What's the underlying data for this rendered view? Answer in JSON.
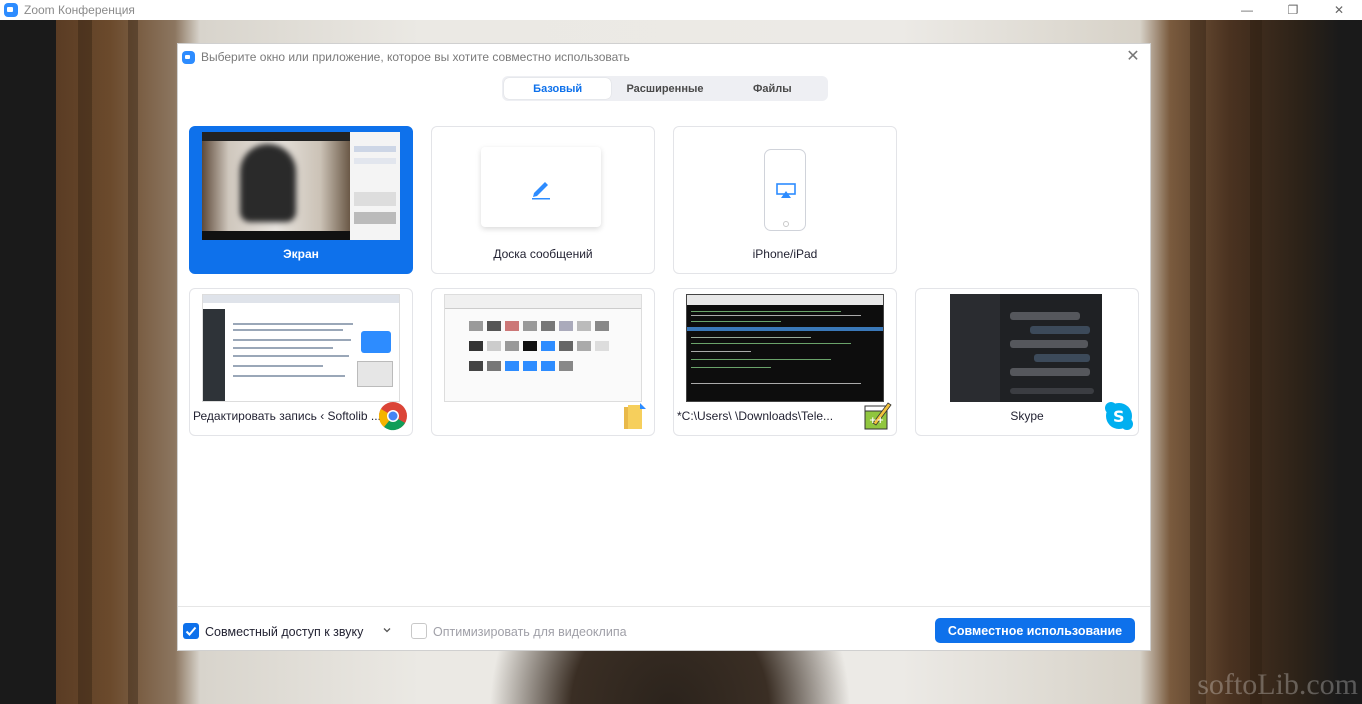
{
  "window": {
    "title": "Zoom Конференция",
    "controls": {
      "minimize": "—",
      "restore": "❐",
      "close": "✕"
    }
  },
  "dialog": {
    "title": "Выберите окно или приложение, которое вы хотите совместно использовать",
    "close": "✕",
    "tabs": [
      {
        "label": "Базовый",
        "active": true
      },
      {
        "label": "Расширенные",
        "active": false
      },
      {
        "label": "Файлы",
        "active": false
      }
    ],
    "sources": [
      {
        "label": "Экран",
        "selected": true
      },
      {
        "label": "Доска сообщений",
        "selected": false
      },
      {
        "label": "iPhone/iPad",
        "selected": false
      },
      {
        "label": "Редактировать запись ‹ Softolib ...",
        "selected": false,
        "app_icon": "chrome-icon"
      },
      {
        "label": "",
        "selected": false,
        "app_icon": "explorer-folder-icon"
      },
      {
        "label": "*C:\\Users\\       \\Downloads\\Tele...",
        "selected": false,
        "app_icon": "notepad-plus-plus-icon"
      },
      {
        "label": "Skype",
        "selected": false,
        "app_icon": "skype-icon"
      }
    ]
  },
  "footer": {
    "share_audio": {
      "label": "Совместный доступ к звуку",
      "checked": true
    },
    "optimize_video": {
      "label": "Оптимизировать для видеоклипа",
      "checked": false
    },
    "share_button": "Совместное использование"
  },
  "watermark": "softoLib.com",
  "colors": {
    "accent": "#0e71eb",
    "zoom_blue": "#2d8cff"
  }
}
